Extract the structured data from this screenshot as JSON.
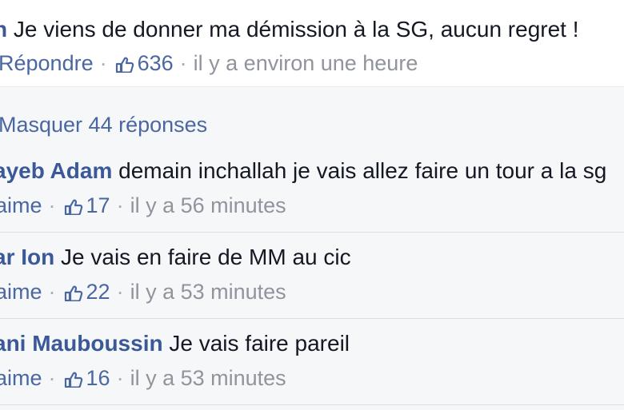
{
  "main_comment": {
    "name_fragment": "n",
    "text": "Je viens de donner ma démission à la SG, aucun regret !",
    "reply_label": "Répondre",
    "likes": "636",
    "time": "il y a environ une heure"
  },
  "replies_toggle": "Masquer 44 réponses",
  "replies": [
    {
      "name": "ayeb Adam",
      "text": "demain inchallah je vais allez faire un tour a la sg",
      "like_label": "aime",
      "likes": "17",
      "time": "il y a 56 minutes"
    },
    {
      "name": "ar Ion",
      "text": "Je vais en faire de MM au cic",
      "like_label": "aime",
      "likes": "22",
      "time": "il y a 53 minutes"
    },
    {
      "name": "ani Mauboussin",
      "text": "Je vais faire pareil",
      "like_label": "aime",
      "likes": "16",
      "time": "il y a 53 minutes"
    }
  ],
  "colors": {
    "link": "#3b5998",
    "meta": "#90949c",
    "replies_bg": "#f6f7f9"
  },
  "icons": [
    "thumbs-up-icon"
  ]
}
